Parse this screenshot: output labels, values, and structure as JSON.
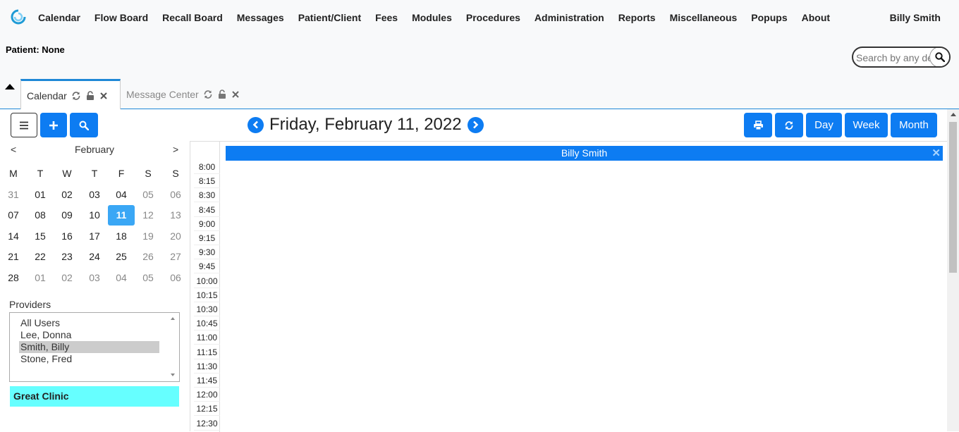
{
  "nav": {
    "items": [
      {
        "label": "Calendar"
      },
      {
        "label": "Flow Board"
      },
      {
        "label": "Recall Board"
      },
      {
        "label": "Messages"
      },
      {
        "label": "Patient/Client"
      },
      {
        "label": "Fees"
      },
      {
        "label": "Modules"
      },
      {
        "label": "Procedures"
      },
      {
        "label": "Administration"
      },
      {
        "label": "Reports"
      },
      {
        "label": "Miscellaneous"
      },
      {
        "label": "Popups"
      },
      {
        "label": "About"
      }
    ],
    "user": "Billy Smith"
  },
  "patient_label": "Patient: None",
  "search": {
    "placeholder": "Search by any demographics"
  },
  "tabs": [
    {
      "label": "Calendar",
      "active": true
    },
    {
      "label": "Message Center",
      "active": false
    }
  ],
  "calendar": {
    "date_title": "Friday, February 11, 2022",
    "view_buttons": {
      "day": "Day",
      "week": "Week",
      "month": "Month"
    },
    "mini": {
      "prev": "<",
      "next": ">",
      "month": "February",
      "weekdays": [
        "M",
        "T",
        "W",
        "T",
        "F",
        "S",
        "S"
      ],
      "weeks": [
        [
          "31",
          "01",
          "02",
          "03",
          "04",
          "05",
          "06"
        ],
        [
          "07",
          "08",
          "09",
          "10",
          "11",
          "12",
          "13"
        ],
        [
          "14",
          "15",
          "16",
          "17",
          "18",
          "19",
          "20"
        ],
        [
          "21",
          "22",
          "23",
          "24",
          "25",
          "26",
          "27"
        ],
        [
          "28",
          "01",
          "02",
          "03",
          "04",
          "05",
          "06"
        ]
      ],
      "selected": "11"
    },
    "providers_label": "Providers",
    "providers": [
      {
        "name": "All Users",
        "selected": false
      },
      {
        "name": "Lee, Donna",
        "selected": false
      },
      {
        "name": "Smith, Billy",
        "selected": true
      },
      {
        "name": "Stone, Fred",
        "selected": false
      }
    ],
    "facility": "Great Clinic",
    "schedule_provider": "Billy Smith",
    "times": [
      "8:00",
      "8:15",
      "8:30",
      "8:45",
      "9:00",
      "9:15",
      "9:30",
      "9:45",
      "10:00",
      "10:15",
      "10:30",
      "10:45",
      "11:00",
      "11:15",
      "11:30",
      "11:45",
      "12:00",
      "12:15",
      "12:30"
    ]
  },
  "colors": {
    "accent": "#0d7cf2",
    "selected_day": "#3aa7f5",
    "facility": "#66ffff",
    "tab_border": "#1f88d6"
  },
  "icons": {
    "logo": "app-logo-icon",
    "search": "search-icon",
    "refresh": "refresh-icon",
    "lock": "unlock-icon",
    "close": "close-icon",
    "menu": "menu-icon",
    "plus": "plus-icon",
    "print": "print-icon"
  }
}
